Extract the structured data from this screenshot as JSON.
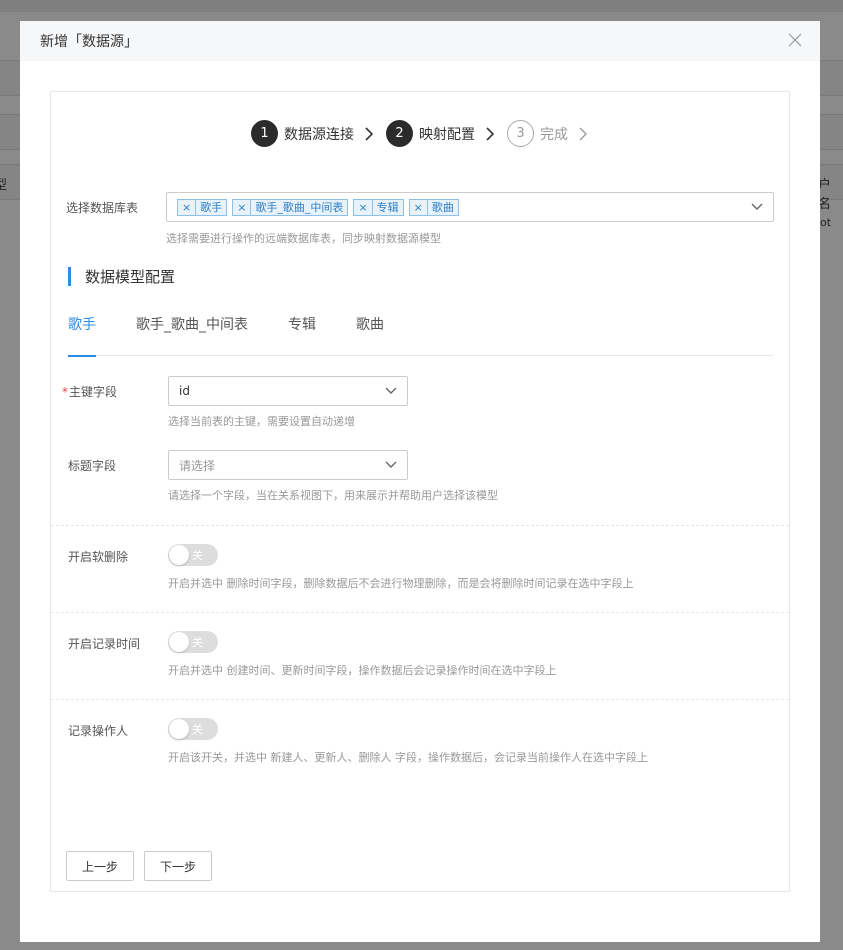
{
  "background": {
    "fragment_left": "型",
    "fragment_right": "户名",
    "fragment_right_small": "ot"
  },
  "modal": {
    "title": "新增「数据源」"
  },
  "steps": [
    {
      "number": "1",
      "label": "数据源连接",
      "state": "done"
    },
    {
      "number": "2",
      "label": "映射配置",
      "state": "active"
    },
    {
      "number": "3",
      "label": "完成",
      "state": "todo"
    }
  ],
  "db_tables": {
    "label": "选择数据库表",
    "selected": [
      "歌手",
      "歌手_歌曲_中间表",
      "专辑",
      "歌曲"
    ],
    "hint": "选择需要进行操作的远端数据库表，同步映射数据源模型"
  },
  "section": {
    "title": "数据模型配置"
  },
  "tabs": [
    {
      "label": "歌手",
      "active": true
    },
    {
      "label": "歌手_歌曲_中间表",
      "active": false
    },
    {
      "label": "专辑",
      "active": false
    },
    {
      "label": "歌曲",
      "active": false
    }
  ],
  "primary_key": {
    "required_mark": "*",
    "label": "主键字段",
    "value": "id",
    "hint": "选择当前表的主键，需要设置自动递增"
  },
  "title_field": {
    "label": "标题字段",
    "placeholder": "请选择",
    "hint": "请选择一个字段，当在关系视图下，用来展示并帮助用户选择该模型"
  },
  "soft_delete": {
    "label": "开启软删除",
    "switch_text": "关",
    "hint": "开启并选中 删除时间字段，删除数据后不会进行物理删除，而是会将删除时间记录在选中字段上"
  },
  "record_time": {
    "label": "开启记录时间",
    "switch_text": "关",
    "hint": "开启并选中 创建时间、更新时间字段，操作数据后会记录操作时间在选中字段上"
  },
  "record_operator": {
    "label": "记录操作人",
    "switch_text": "关",
    "hint": "开启该开关，并选中 新建人、更新人、删除人 字段，操作数据后，会记录当前操作人在选中字段上"
  },
  "footer": {
    "prev_label": "上一步",
    "next_label": "下一步"
  },
  "colors": {
    "accent": "#2b8ce4",
    "tag_bg": "#e7f2fb",
    "required": "#e5484d"
  }
}
